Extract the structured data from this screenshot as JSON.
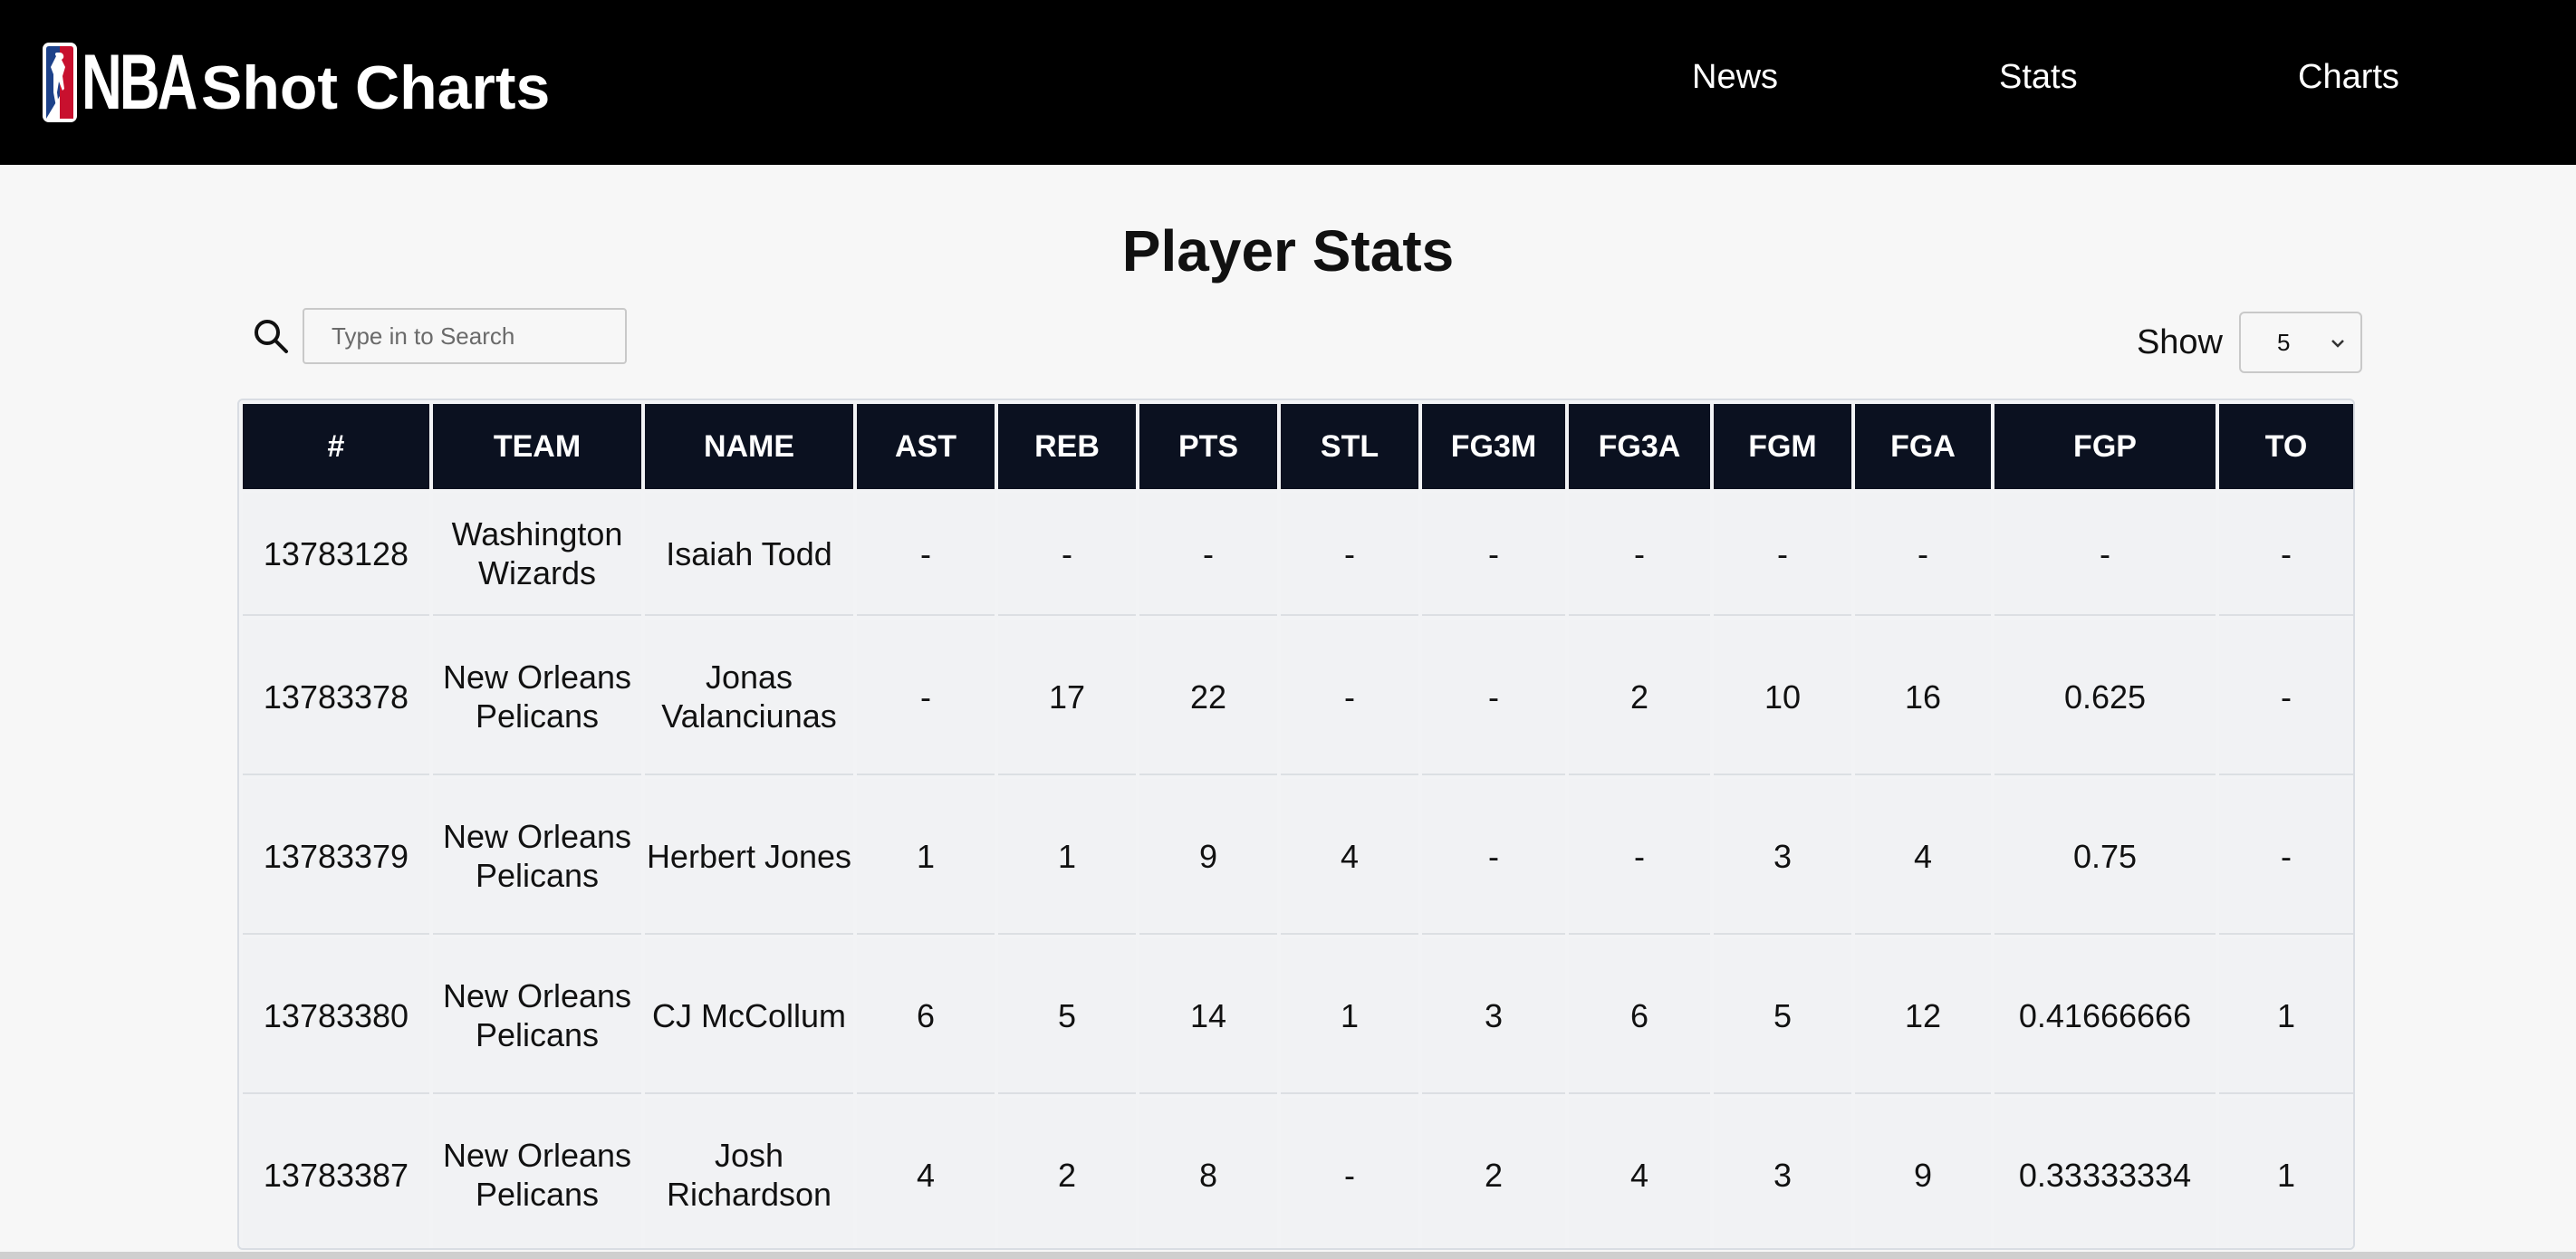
{
  "header": {
    "logo_text": "NBA",
    "title": "Shot Charts",
    "nav": [
      {
        "label": "News"
      },
      {
        "label": "Stats"
      },
      {
        "label": "Charts"
      }
    ]
  },
  "main": {
    "title": "Player Stats",
    "search": {
      "placeholder": "Type in to Search",
      "value": ""
    },
    "show": {
      "label": "Show",
      "selected": "5"
    }
  },
  "table": {
    "columns": [
      "#",
      "TEAM",
      "NAME",
      "AST",
      "REB",
      "PTS",
      "STL",
      "FG3M",
      "FG3A",
      "FGM",
      "FGA",
      "FGP",
      "TO"
    ],
    "rows": [
      [
        "13783128",
        "Washington Wizards",
        "Isaiah Todd",
        "-",
        "-",
        "-",
        "-",
        "-",
        "-",
        "-",
        "-",
        "-",
        "-"
      ],
      [
        "13783378",
        "New Orleans Pelicans",
        "Jonas Valanciunas",
        "-",
        "17",
        "22",
        "-",
        "-",
        "2",
        "10",
        "16",
        "0.625",
        "-"
      ],
      [
        "13783379",
        "New Orleans Pelicans",
        "Herbert Jones",
        "1",
        "1",
        "9",
        "4",
        "-",
        "-",
        "3",
        "4",
        "0.75",
        "-"
      ],
      [
        "13783380",
        "New Orleans Pelicans",
        "CJ McCollum",
        "6",
        "5",
        "14",
        "1",
        "3",
        "6",
        "5",
        "12",
        "0.41666666",
        "1"
      ],
      [
        "13783387",
        "New Orleans Pelicans",
        "Josh Richardson",
        "4",
        "2",
        "8",
        "-",
        "2",
        "4",
        "3",
        "9",
        "0.33333334",
        "1"
      ]
    ]
  },
  "colors": {
    "header_bg": "#000000",
    "table_header_bg": "#0b1120",
    "page_bg": "#f7f7f7",
    "logo_red": "#c8102e",
    "logo_blue": "#1d428a"
  }
}
